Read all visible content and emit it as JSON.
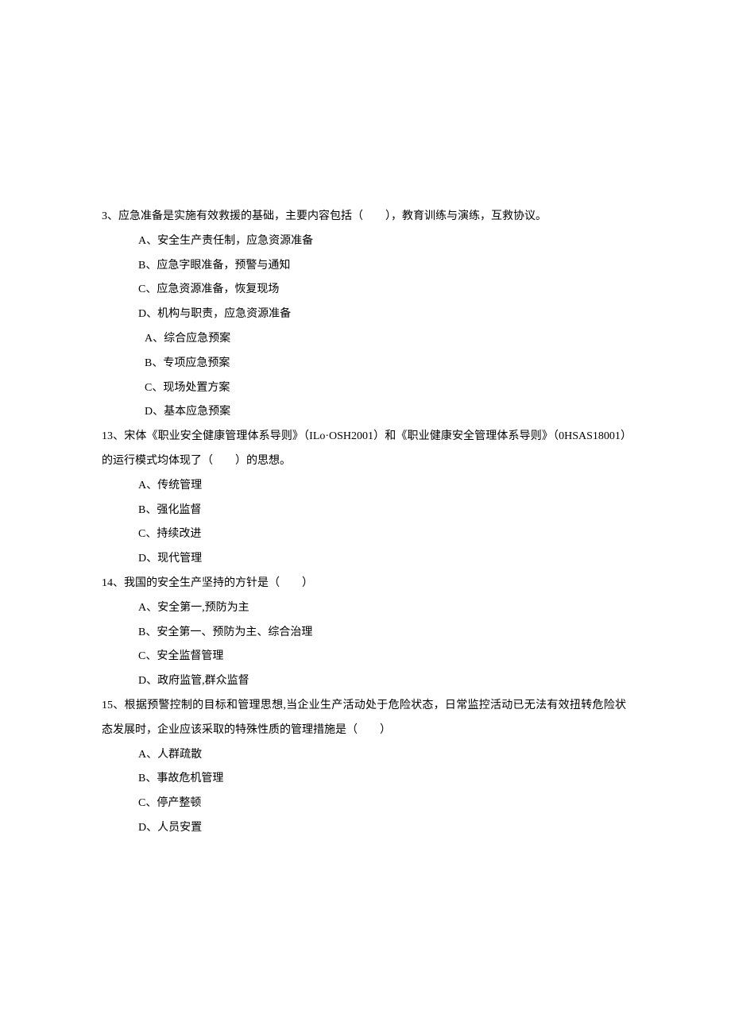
{
  "q3": {
    "stem": "3、应急准备是实施有效救援的基础，主要内容包括（　　），教育训练与演练，互救协议。",
    "optA": "A、安全生产责任制，应急资源准备",
    "optB": "B、应急字眼准备，预警与通知",
    "optC": "C、应急资源准备，恢复现场",
    "optD": "D、机构与职责，应急资源准备",
    "subA": "A、综合应急预案",
    "subB": "B、专项应急预案",
    "subC": "C、现场处置方案",
    "subD": "D、基本应急预案"
  },
  "q13": {
    "stem": "13、宋体《职业安全健康管理体系导则》（ILo·OSH2001）和《职业健康安全管理体系导则》（0HSAS18001）的运行模式均体现了（　　）的思想。",
    "optA": "A、传统管理",
    "optB": "B、强化监督",
    "optC": "C、持续改进",
    "optD": "D、现代管理"
  },
  "q14": {
    "stem": "14、我国的安全生产坚持的方针是（　　）",
    "optA": "A、安全第一,预防为主",
    "optB": "B、安全第一、预防为主、综合治理",
    "optC": "C、安全监督管理",
    "optD": "D、政府监管,群众监督"
  },
  "q15": {
    "stem": "15、根据预警控制的目标和管理思想,当企业生产活动处于危险状态，日常监控活动已无法有效扭转危险状态发展时，企业应该采取的特殊性质的管理措施是（　　）",
    "optA": "A、人群疏散",
    "optB": "B、事故危机管理",
    "optC": "C、停产整顿",
    "optD": "D、人员安置"
  }
}
